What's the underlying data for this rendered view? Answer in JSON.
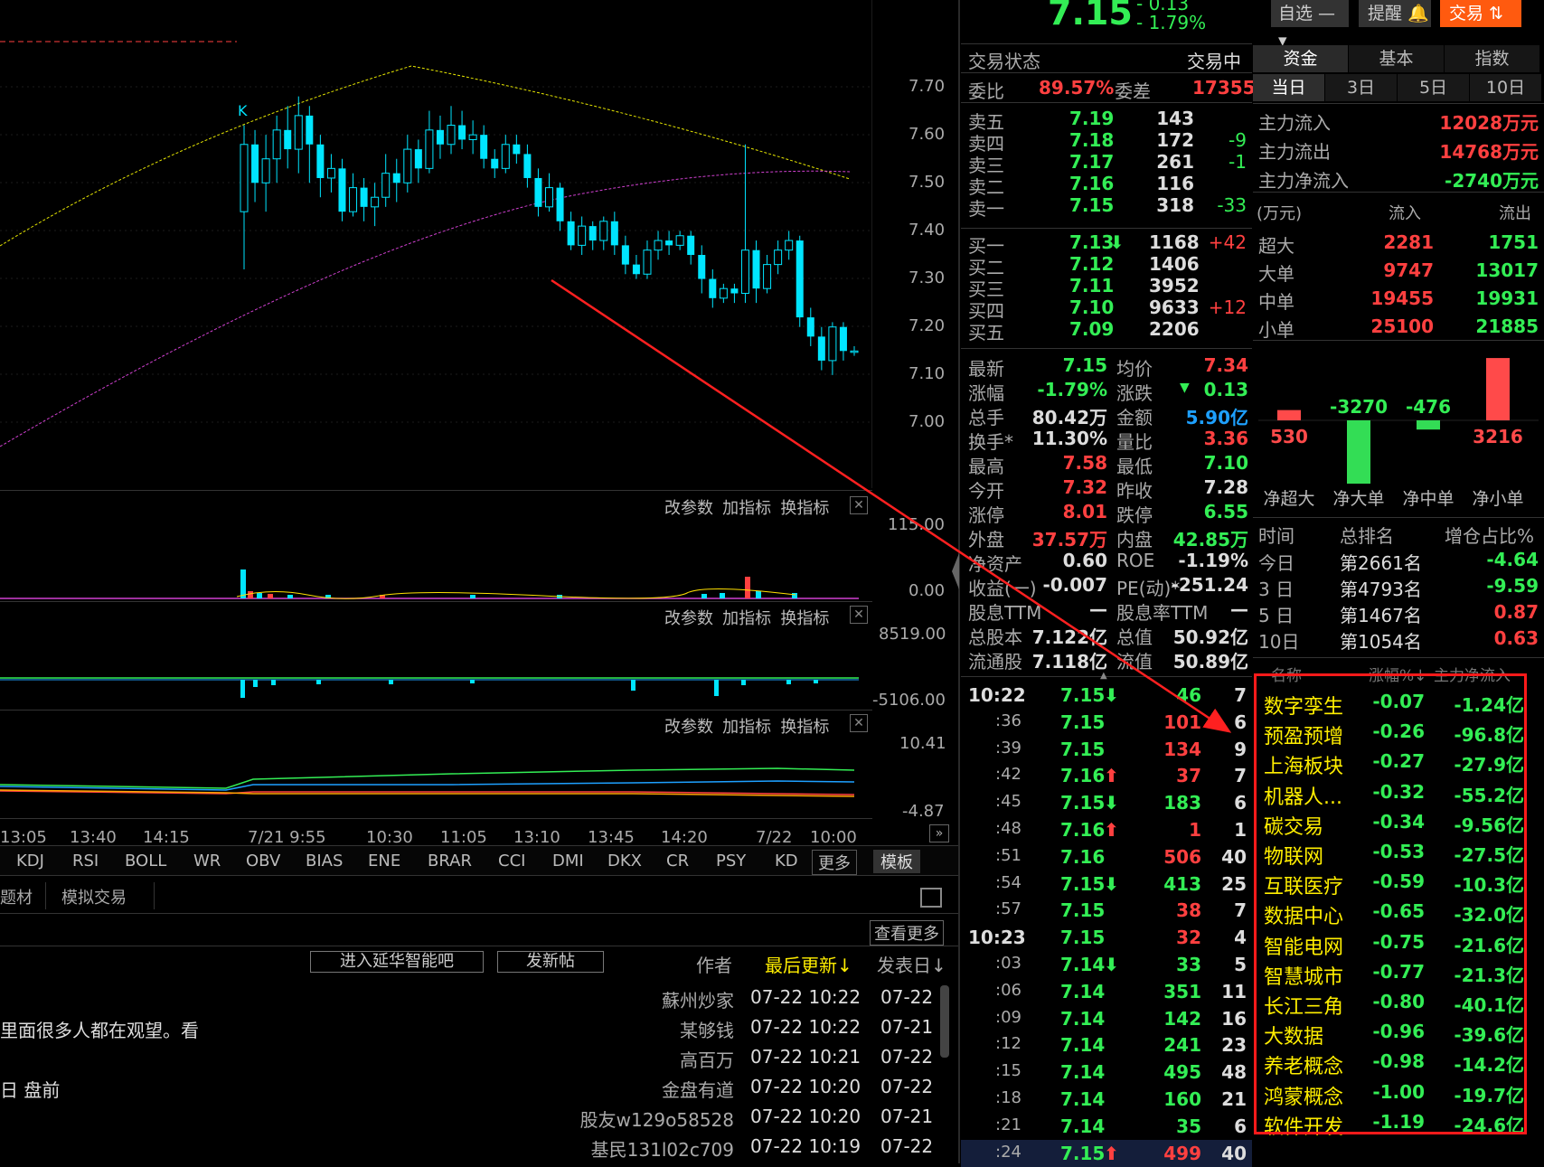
{
  "quote": {
    "price": "7.15",
    "change": "- 0.13",
    "pct": "- 1.79%"
  },
  "topbar": {
    "watch": "自选",
    "remind": "提醒",
    "trade": "交易"
  },
  "status": {
    "label": "交易状态",
    "value": "交易中"
  },
  "ratio": {
    "l1": "委比",
    "v1": "89.57%",
    "l2": "委差",
    "v2": "17355"
  },
  "sells": [
    {
      "label": "卖五",
      "price": "7.19",
      "vol": "143",
      "chg": ""
    },
    {
      "label": "卖四",
      "price": "7.18",
      "vol": "172",
      "chg": "-9"
    },
    {
      "label": "卖三",
      "price": "7.17",
      "vol": "261",
      "chg": "-1"
    },
    {
      "label": "卖二",
      "price": "7.16",
      "vol": "116",
      "chg": ""
    },
    {
      "label": "卖一",
      "price": "7.15",
      "vol": "318",
      "chg": "-33"
    }
  ],
  "buys": [
    {
      "label": "买一",
      "price": "7.13",
      "vol": "1168",
      "chg": "+42"
    },
    {
      "label": "买二",
      "price": "7.12",
      "vol": "1406",
      "chg": ""
    },
    {
      "label": "买三",
      "price": "7.11",
      "vol": "3952",
      "chg": ""
    },
    {
      "label": "买四",
      "price": "7.10",
      "vol": "9633",
      "chg": "+12"
    },
    {
      "label": "买五",
      "price": "7.09",
      "vol": "2206",
      "chg": ""
    }
  ],
  "stats": [
    {
      "l1": "最新",
      "v1": "7.15",
      "l2": "均价",
      "v2": "7.34"
    },
    {
      "l1": "涨幅",
      "v1": "-1.79%",
      "l2": "涨跌",
      "v2": "0.13"
    },
    {
      "l1": "总手",
      "v1": "80.42万",
      "l2": "金额",
      "v2": "5.90亿"
    },
    {
      "l1": "换手*",
      "v1": "11.30%",
      "l2": "量比",
      "v2": "3.36"
    },
    {
      "l1": "最高",
      "v1": "7.58",
      "l2": "最低",
      "v2": "7.10"
    },
    {
      "l1": "今开",
      "v1": "7.32",
      "l2": "昨收",
      "v2": "7.28"
    },
    {
      "l1": "涨停",
      "v1": "8.01",
      "l2": "跌停",
      "v2": "6.55"
    },
    {
      "l1": "外盘",
      "v1": "37.57万",
      "l2": "内盘",
      "v2": "42.85万"
    },
    {
      "l1": "净资产",
      "v1": "0.60",
      "l2": "ROE",
      "v2": "-1.19%"
    },
    {
      "l1": "收益(一)",
      "v1": "-0.007",
      "l2": "PE(动)*",
      "v2": "-251.24"
    },
    {
      "l1": "股息TTM",
      "v1": "—",
      "l2": "股息率TTM",
      "v2": "—"
    },
    {
      "l1": "总股本",
      "v1": "7.122亿",
      "l2": "总值",
      "v2": "50.92亿"
    },
    {
      "l1": "流通股",
      "v1": "7.118亿",
      "l2": "流值",
      "v2": "50.89亿"
    }
  ],
  "ticks": [
    {
      "t": "10:22",
      "p": "7.15",
      "v": "46",
      "n": "7",
      "arrow": "↓",
      "vc": "g"
    },
    {
      "t": ":36",
      "p": "7.15",
      "v": "101",
      "n": "6",
      "arrow": "",
      "vc": "r"
    },
    {
      "t": ":39",
      "p": "7.15",
      "v": "134",
      "n": "9",
      "arrow": "",
      "vc": "r"
    },
    {
      "t": ":42",
      "p": "7.16",
      "v": "37",
      "n": "7",
      "arrow": "↑",
      "vc": "r"
    },
    {
      "t": ":45",
      "p": "7.15",
      "v": "183",
      "n": "6",
      "arrow": "↓",
      "vc": "g"
    },
    {
      "t": ":48",
      "p": "7.16",
      "v": "1",
      "n": "1",
      "arrow": "↑",
      "vc": "r"
    },
    {
      "t": ":51",
      "p": "7.16",
      "v": "506",
      "n": "40",
      "arrow": "",
      "vc": "r"
    },
    {
      "t": ":54",
      "p": "7.15",
      "v": "413",
      "n": "25",
      "arrow": "↓",
      "vc": "g"
    },
    {
      "t": ":57",
      "p": "7.15",
      "v": "38",
      "n": "7",
      "arrow": "",
      "vc": "r"
    },
    {
      "t": "10:23",
      "p": "7.15",
      "v": "32",
      "n": "4",
      "arrow": "",
      "vc": "r"
    },
    {
      "t": ":03",
      "p": "7.14",
      "v": "33",
      "n": "5",
      "arrow": "↓",
      "vc": "g"
    },
    {
      "t": ":06",
      "p": "7.14",
      "v": "351",
      "n": "11",
      "arrow": "",
      "vc": "g"
    },
    {
      "t": ":09",
      "p": "7.14",
      "v": "142",
      "n": "16",
      "arrow": "",
      "vc": "g"
    },
    {
      "t": ":12",
      "p": "7.14",
      "v": "241",
      "n": "23",
      "arrow": "",
      "vc": "g"
    },
    {
      "t": ":15",
      "p": "7.14",
      "v": "495",
      "n": "48",
      "arrow": "",
      "vc": "g"
    },
    {
      "t": ":18",
      "p": "7.14",
      "v": "160",
      "n": "21",
      "arrow": "",
      "vc": "g"
    },
    {
      "t": ":21",
      "p": "7.14",
      "v": "35",
      "n": "6",
      "arrow": "",
      "vc": "g"
    },
    {
      "t": ":24",
      "p": "7.15",
      "v": "499",
      "n": "40",
      "arrow": "↑",
      "vc": "r"
    }
  ],
  "fundtabs": {
    "tabs": [
      "资金",
      "基本",
      "指数"
    ],
    "periods": [
      "当日",
      "3日",
      "5日",
      "10日"
    ]
  },
  "flow": [
    {
      "l": "主力流入",
      "v": "12028万元"
    },
    {
      "l": "主力流出",
      "v": "14768万元"
    },
    {
      "l": "主力净流入",
      "v": "-2740万元"
    }
  ],
  "flowhead": {
    "u": "(万元)",
    "in": "流入",
    "out": "流出"
  },
  "flowrows": [
    {
      "l": "超大",
      "in": "2281",
      "out": "1751"
    },
    {
      "l": "大单",
      "in": "9747",
      "out": "13017"
    },
    {
      "l": "中单",
      "in": "19455",
      "out": "19931"
    },
    {
      "l": "小单",
      "in": "25100",
      "out": "21885"
    }
  ],
  "netbars": [
    {
      "name": "净超大",
      "value": 530
    },
    {
      "name": "净大单",
      "value": -3270
    },
    {
      "name": "净中单",
      "value": -476
    },
    {
      "name": "净小单",
      "value": 3216
    }
  ],
  "rankhead": {
    "a": "时间",
    "b": "总排名",
    "c": "增仓占比%"
  },
  "ranks": [
    {
      "a": "今日",
      "b": "第2661名",
      "c": "-4.64"
    },
    {
      "a": "3 日",
      "b": "第4793名",
      "c": "-9.59"
    },
    {
      "a": "5 日",
      "b": "第1467名",
      "c": "0.87"
    },
    {
      "a": "10日",
      "b": "第1054名",
      "c": "0.63"
    }
  ],
  "sectorhead": {
    "a": "名称",
    "b": "涨幅%↓",
    "c": "主力净流入"
  },
  "sectors": [
    {
      "n": "数字孪生",
      "p": "-0.07",
      "f": "-1.24亿"
    },
    {
      "n": "预盈预增",
      "p": "-0.26",
      "f": "-96.8亿"
    },
    {
      "n": "上海板块",
      "p": "-0.27",
      "f": "-27.9亿"
    },
    {
      "n": "机器人...",
      "p": "-0.32",
      "f": "-55.2亿"
    },
    {
      "n": "碳交易",
      "p": "-0.34",
      "f": "-9.56亿"
    },
    {
      "n": "物联网",
      "p": "-0.53",
      "f": "-27.5亿"
    },
    {
      "n": "互联医疗",
      "p": "-0.59",
      "f": "-10.3亿"
    },
    {
      "n": "数据中心",
      "p": "-0.65",
      "f": "-32.0亿"
    },
    {
      "n": "智能电网",
      "p": "-0.75",
      "f": "-21.6亿"
    },
    {
      "n": "智慧城市",
      "p": "-0.77",
      "f": "-21.3亿"
    },
    {
      "n": "长江三角",
      "p": "-0.80",
      "f": "-40.1亿"
    },
    {
      "n": "大数据",
      "p": "-0.96",
      "f": "-39.6亿"
    },
    {
      "n": "养老概念",
      "p": "-0.98",
      "f": "-14.2亿"
    },
    {
      "n": "鸿蒙概念",
      "p": "-1.00",
      "f": "-19.7亿"
    },
    {
      "n": "软件开发",
      "p": "-1.19",
      "f": "-24.6亿"
    }
  ],
  "chart": {
    "yaxis": [
      "7.70",
      "7.60",
      "7.50",
      "7.40",
      "7.30",
      "7.20",
      "7.10",
      "7.00"
    ],
    "panel_controls": [
      "改参数",
      "加指标",
      "换指标"
    ],
    "vol_axis": [
      "115.00",
      "0.00"
    ],
    "ind2_axis": [
      "8519.00",
      "-5106.00"
    ],
    "ind3_axis": [
      "10.41",
      "-4.87"
    ],
    "xaxis": [
      "13:05",
      "13:40",
      "14:15",
      "7/21 9:55",
      "10:30",
      "11:05",
      "13:10",
      "13:45",
      "14:20",
      "7/22",
      "10:00"
    ],
    "indicators": [
      "KDJ",
      "RSI",
      "BOLL",
      "WR",
      "OBV",
      "BIAS",
      "ENE",
      "BRAR",
      "CCI",
      "DMI",
      "DKX",
      "CR",
      "PSY",
      "KD"
    ],
    "more": "更多",
    "template": "模板",
    "kmark": "K"
  },
  "chart_data": {
    "type": "candlestick",
    "yrange": [
      7.0,
      7.7
    ],
    "candles": [
      [
        7.44,
        7.58,
        7.32,
        7.62
      ],
      [
        7.58,
        7.5,
        7.46,
        7.61
      ],
      [
        7.5,
        7.55,
        7.44,
        7.6
      ],
      [
        7.55,
        7.61,
        7.5,
        7.64
      ],
      [
        7.61,
        7.57,
        7.53,
        7.66
      ],
      [
        7.57,
        7.64,
        7.52,
        7.68
      ],
      [
        7.64,
        7.58,
        7.5,
        7.66
      ],
      [
        7.58,
        7.51,
        7.47,
        7.6
      ],
      [
        7.51,
        7.53,
        7.48,
        7.56
      ],
      [
        7.53,
        7.44,
        7.42,
        7.55
      ],
      [
        7.44,
        7.49,
        7.43,
        7.52
      ],
      [
        7.49,
        7.45,
        7.42,
        7.51
      ],
      [
        7.45,
        7.47,
        7.41,
        7.5
      ],
      [
        7.47,
        7.52,
        7.45,
        7.56
      ],
      [
        7.52,
        7.5,
        7.46,
        7.55
      ],
      [
        7.5,
        7.57,
        7.48,
        7.6
      ],
      [
        7.57,
        7.53,
        7.5,
        7.59
      ],
      [
        7.53,
        7.61,
        7.52,
        7.65
      ],
      [
        7.61,
        7.58,
        7.55,
        7.64
      ],
      [
        7.58,
        7.62,
        7.56,
        7.66
      ],
      [
        7.62,
        7.59,
        7.57,
        7.65
      ],
      [
        7.59,
        7.6,
        7.56,
        7.63
      ],
      [
        7.6,
        7.55,
        7.53,
        7.62
      ],
      [
        7.55,
        7.53,
        7.51,
        7.57
      ],
      [
        7.53,
        7.58,
        7.52,
        7.6
      ],
      [
        7.58,
        7.56,
        7.54,
        7.6
      ],
      [
        7.56,
        7.51,
        7.49,
        7.58
      ],
      [
        7.51,
        7.45,
        7.43,
        7.53
      ],
      [
        7.45,
        7.49,
        7.44,
        7.52
      ],
      [
        7.49,
        7.42,
        7.4,
        7.5
      ],
      [
        7.42,
        7.37,
        7.36,
        7.44
      ],
      [
        7.37,
        7.41,
        7.35,
        7.43
      ],
      [
        7.41,
        7.38,
        7.36,
        7.42
      ],
      [
        7.38,
        7.42,
        7.36,
        7.43
      ],
      [
        7.42,
        7.37,
        7.35,
        7.44
      ],
      [
        7.37,
        7.33,
        7.31,
        7.39
      ],
      [
        7.33,
        7.31,
        7.3,
        7.35
      ],
      [
        7.31,
        7.36,
        7.3,
        7.38
      ],
      [
        7.36,
        7.38,
        7.34,
        7.4
      ],
      [
        7.38,
        7.37,
        7.35,
        7.4
      ],
      [
        7.37,
        7.39,
        7.36,
        7.4
      ],
      [
        7.39,
        7.35,
        7.33,
        7.4
      ],
      [
        7.35,
        7.3,
        7.27,
        7.37
      ],
      [
        7.3,
        7.26,
        7.24,
        7.32
      ],
      [
        7.26,
        7.28,
        7.25,
        7.29
      ],
      [
        7.28,
        7.27,
        7.25,
        7.29
      ],
      [
        7.27,
        7.36,
        7.25,
        7.58
      ],
      [
        7.36,
        7.28,
        7.25,
        7.38
      ],
      [
        7.28,
        7.33,
        7.27,
        7.35
      ],
      [
        7.33,
        7.36,
        7.31,
        7.38
      ],
      [
        7.36,
        7.38,
        7.34,
        7.4
      ],
      [
        7.38,
        7.22,
        7.2,
        7.39
      ],
      [
        7.22,
        7.18,
        7.16,
        7.24
      ],
      [
        7.18,
        7.13,
        7.11,
        7.2
      ],
      [
        7.13,
        7.2,
        7.1,
        7.21
      ],
      [
        7.2,
        7.15,
        7.13,
        7.21
      ],
      [
        7.15,
        7.15,
        7.14,
        7.16
      ]
    ]
  },
  "bottom": {
    "tabs": [
      "题材",
      "模拟交易"
    ],
    "more": "查看更多",
    "btn1": "进入延华智能吧",
    "btn2": "发新帖",
    "hdr": {
      "a": "作者",
      "b": "最后更新↓",
      "c": "发表日↓"
    },
    "posts": [
      {
        "title": "",
        "author": "蘇州炒家",
        "upd": "07-22 10:22",
        "date": "07-22"
      },
      {
        "title": "里面很多人都在观望。看",
        "author": "某够钱",
        "upd": "07-22 10:22",
        "date": "07-21"
      },
      {
        "title": "",
        "author": "高百万",
        "upd": "07-22 10:21",
        "date": "07-22"
      },
      {
        "title": "日 盘前",
        "author": "金盘有道",
        "upd": "07-22 10:20",
        "date": "07-22"
      },
      {
        "title": "",
        "author": "股友w129o58528",
        "upd": "07-22 10:20",
        "date": "07-21"
      },
      {
        "title": "",
        "author": "基民131l02c709",
        "upd": "07-22 10:19",
        "date": "07-22"
      }
    ]
  }
}
